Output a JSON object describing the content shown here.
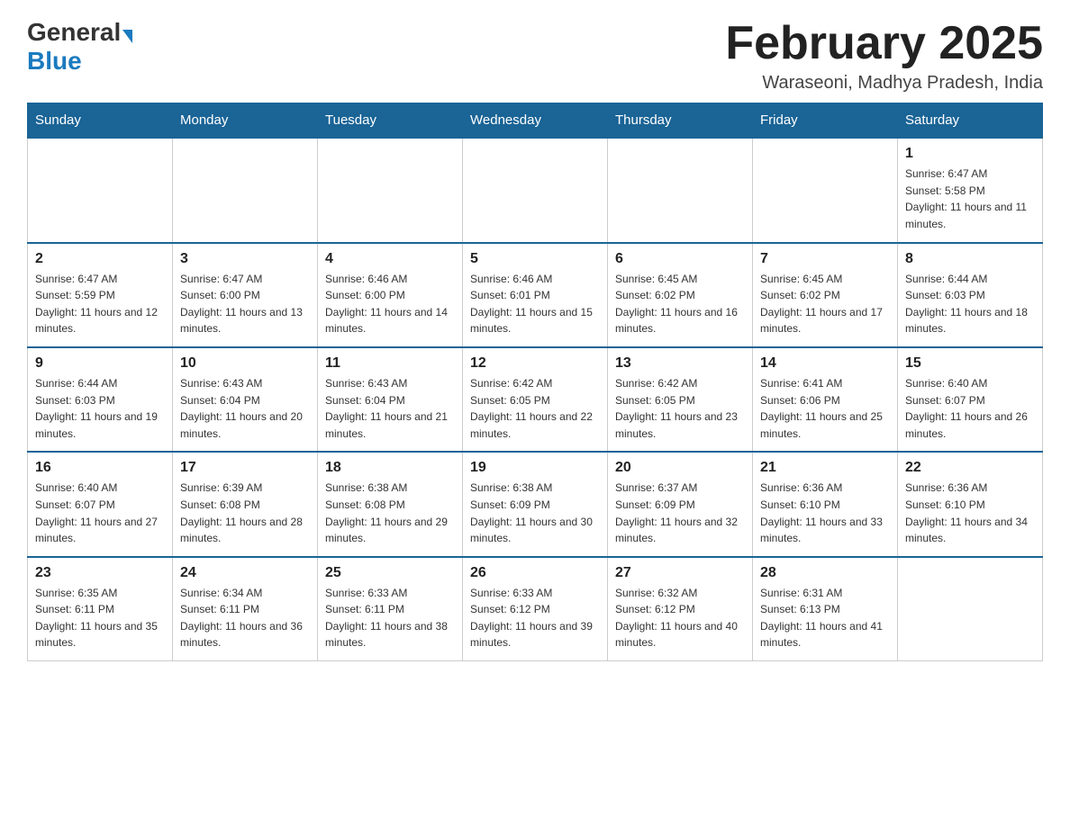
{
  "header": {
    "logo_general": "General",
    "logo_blue": "Blue",
    "month_title": "February 2025",
    "location": "Waraseoni, Madhya Pradesh, India"
  },
  "days_of_week": [
    "Sunday",
    "Monday",
    "Tuesday",
    "Wednesday",
    "Thursday",
    "Friday",
    "Saturday"
  ],
  "weeks": [
    [
      {
        "day": "",
        "info": ""
      },
      {
        "day": "",
        "info": ""
      },
      {
        "day": "",
        "info": ""
      },
      {
        "day": "",
        "info": ""
      },
      {
        "day": "",
        "info": ""
      },
      {
        "day": "",
        "info": ""
      },
      {
        "day": "1",
        "info": "Sunrise: 6:47 AM\nSunset: 5:58 PM\nDaylight: 11 hours and 11 minutes."
      }
    ],
    [
      {
        "day": "2",
        "info": "Sunrise: 6:47 AM\nSunset: 5:59 PM\nDaylight: 11 hours and 12 minutes."
      },
      {
        "day": "3",
        "info": "Sunrise: 6:47 AM\nSunset: 6:00 PM\nDaylight: 11 hours and 13 minutes."
      },
      {
        "day": "4",
        "info": "Sunrise: 6:46 AM\nSunset: 6:00 PM\nDaylight: 11 hours and 14 minutes."
      },
      {
        "day": "5",
        "info": "Sunrise: 6:46 AM\nSunset: 6:01 PM\nDaylight: 11 hours and 15 minutes."
      },
      {
        "day": "6",
        "info": "Sunrise: 6:45 AM\nSunset: 6:02 PM\nDaylight: 11 hours and 16 minutes."
      },
      {
        "day": "7",
        "info": "Sunrise: 6:45 AM\nSunset: 6:02 PM\nDaylight: 11 hours and 17 minutes."
      },
      {
        "day": "8",
        "info": "Sunrise: 6:44 AM\nSunset: 6:03 PM\nDaylight: 11 hours and 18 minutes."
      }
    ],
    [
      {
        "day": "9",
        "info": "Sunrise: 6:44 AM\nSunset: 6:03 PM\nDaylight: 11 hours and 19 minutes."
      },
      {
        "day": "10",
        "info": "Sunrise: 6:43 AM\nSunset: 6:04 PM\nDaylight: 11 hours and 20 minutes."
      },
      {
        "day": "11",
        "info": "Sunrise: 6:43 AM\nSunset: 6:04 PM\nDaylight: 11 hours and 21 minutes."
      },
      {
        "day": "12",
        "info": "Sunrise: 6:42 AM\nSunset: 6:05 PM\nDaylight: 11 hours and 22 minutes."
      },
      {
        "day": "13",
        "info": "Sunrise: 6:42 AM\nSunset: 6:05 PM\nDaylight: 11 hours and 23 minutes."
      },
      {
        "day": "14",
        "info": "Sunrise: 6:41 AM\nSunset: 6:06 PM\nDaylight: 11 hours and 25 minutes."
      },
      {
        "day": "15",
        "info": "Sunrise: 6:40 AM\nSunset: 6:07 PM\nDaylight: 11 hours and 26 minutes."
      }
    ],
    [
      {
        "day": "16",
        "info": "Sunrise: 6:40 AM\nSunset: 6:07 PM\nDaylight: 11 hours and 27 minutes."
      },
      {
        "day": "17",
        "info": "Sunrise: 6:39 AM\nSunset: 6:08 PM\nDaylight: 11 hours and 28 minutes."
      },
      {
        "day": "18",
        "info": "Sunrise: 6:38 AM\nSunset: 6:08 PM\nDaylight: 11 hours and 29 minutes."
      },
      {
        "day": "19",
        "info": "Sunrise: 6:38 AM\nSunset: 6:09 PM\nDaylight: 11 hours and 30 minutes."
      },
      {
        "day": "20",
        "info": "Sunrise: 6:37 AM\nSunset: 6:09 PM\nDaylight: 11 hours and 32 minutes."
      },
      {
        "day": "21",
        "info": "Sunrise: 6:36 AM\nSunset: 6:10 PM\nDaylight: 11 hours and 33 minutes."
      },
      {
        "day": "22",
        "info": "Sunrise: 6:36 AM\nSunset: 6:10 PM\nDaylight: 11 hours and 34 minutes."
      }
    ],
    [
      {
        "day": "23",
        "info": "Sunrise: 6:35 AM\nSunset: 6:11 PM\nDaylight: 11 hours and 35 minutes."
      },
      {
        "day": "24",
        "info": "Sunrise: 6:34 AM\nSunset: 6:11 PM\nDaylight: 11 hours and 36 minutes."
      },
      {
        "day": "25",
        "info": "Sunrise: 6:33 AM\nSunset: 6:11 PM\nDaylight: 11 hours and 38 minutes."
      },
      {
        "day": "26",
        "info": "Sunrise: 6:33 AM\nSunset: 6:12 PM\nDaylight: 11 hours and 39 minutes."
      },
      {
        "day": "27",
        "info": "Sunrise: 6:32 AM\nSunset: 6:12 PM\nDaylight: 11 hours and 40 minutes."
      },
      {
        "day": "28",
        "info": "Sunrise: 6:31 AM\nSunset: 6:13 PM\nDaylight: 11 hours and 41 minutes."
      },
      {
        "day": "",
        "info": ""
      }
    ]
  ]
}
